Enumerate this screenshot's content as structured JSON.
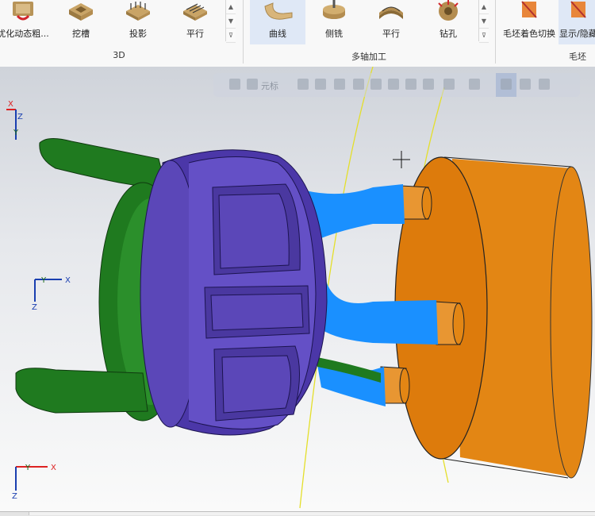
{
  "ribbon": {
    "group_3d": {
      "label": "3D",
      "tools": [
        {
          "label": "优化动态粗...",
          "icon": "optimized-roughing-icon"
        },
        {
          "label": "挖槽",
          "icon": "pocket-icon"
        },
        {
          "label": "投影",
          "icon": "project-icon"
        },
        {
          "label": "平行",
          "icon": "parallel-icon"
        }
      ]
    },
    "group_multiaxis": {
      "label": "多轴加工",
      "tools": [
        {
          "label": "曲线",
          "icon": "curve-icon",
          "active": true
        },
        {
          "label": "侧铣",
          "icon": "swarf-icon"
        },
        {
          "label": "平行",
          "icon": "parallel-multiaxis-icon"
        },
        {
          "label": "钻孔",
          "icon": "drill-icon"
        }
      ]
    },
    "group_stock": {
      "label": "毛坯",
      "tools": [
        {
          "label": "毛坯着色切换",
          "icon": "stock-shading-toggle-icon"
        },
        {
          "label": "显示/隐藏",
          "icon": "stock-show-hide-icon",
          "active": true
        }
      ]
    },
    "scroll_glyphs": {
      "up": "▲",
      "down": "▼",
      "more": "⊽"
    }
  },
  "viewport_toolbar": {
    "selection_mode": "元标"
  },
  "axes": {
    "x": "X",
    "y": "Y",
    "z": "Z"
  },
  "colors": {
    "part_purple": "#5b47b8",
    "part_green": "#1f7a1f",
    "stock_orange": "#e07d10",
    "toolpath_blue": "#1a90ff",
    "toolpath_yellow": "#e4df2a"
  }
}
